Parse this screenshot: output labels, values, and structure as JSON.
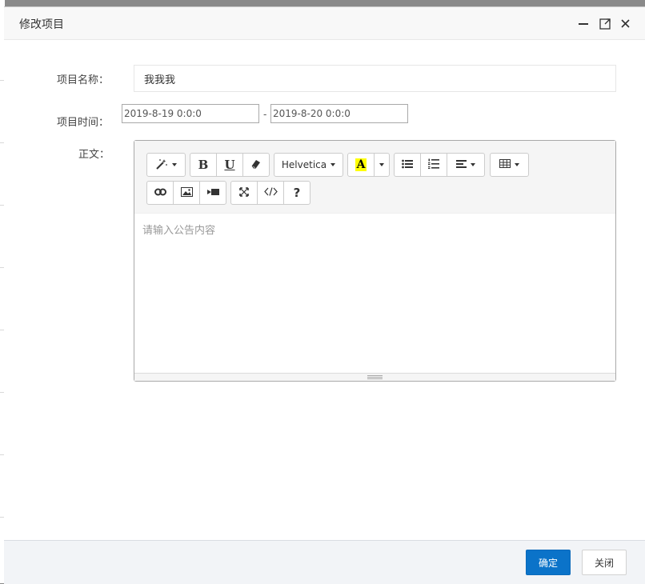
{
  "dialog": {
    "title": "修改项目"
  },
  "form": {
    "name_label": "项目名称：",
    "name_value": "我我我",
    "time_label": "项目时间：",
    "start_date": "2019-8-19 0:0:0",
    "separator": "-",
    "end_date": "2019-8-20 0:0:0",
    "body_label": "正文："
  },
  "editor": {
    "font_name": "Helvetica",
    "color_letter": "A",
    "help_label": "?",
    "placeholder": "请输入公告内容",
    "icons": [
      "magic-wand-icon",
      "eraser-icon",
      "bullet-list-icon",
      "numbered-list-icon",
      "align-icon",
      "table-icon",
      "link-icon",
      "picture-icon",
      "video-icon",
      "fullscreen-icon",
      "code-view-icon"
    ]
  },
  "footer": {
    "ok_label": "确定",
    "close_label": "关闭"
  },
  "colors": {
    "primary": "#0b73c9",
    "highlight": "#ffff00"
  }
}
